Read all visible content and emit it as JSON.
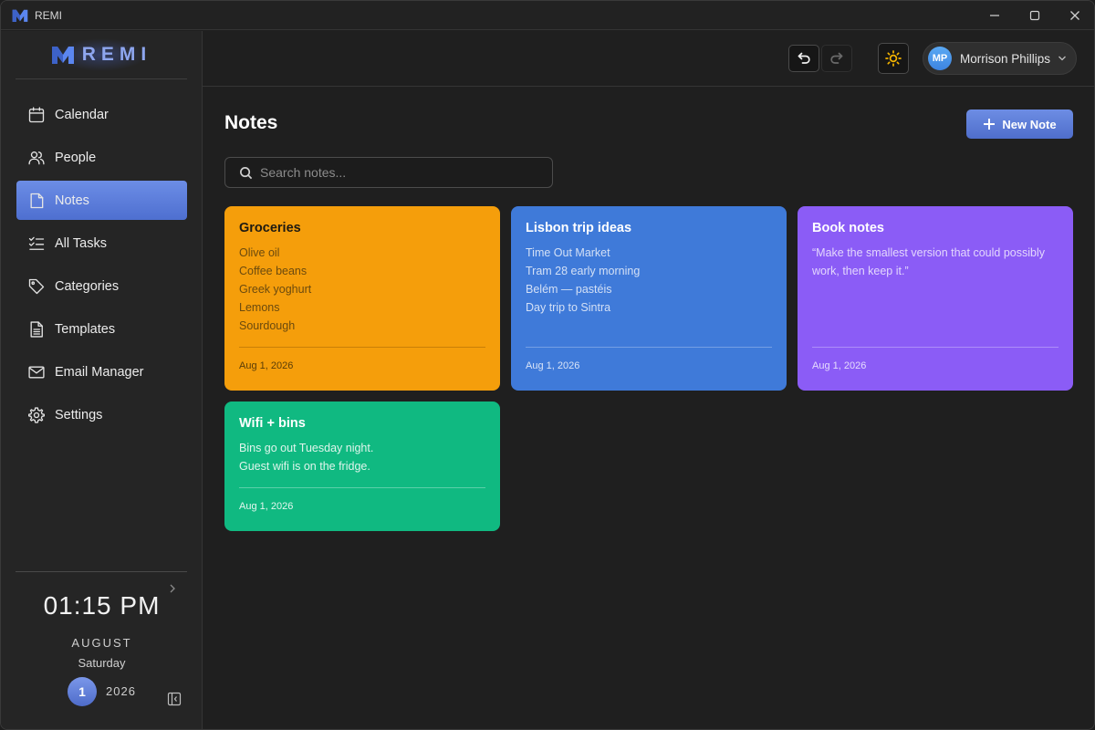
{
  "window": {
    "title": "REMI"
  },
  "brand": {
    "name": "REMI"
  },
  "sidebar": {
    "items": [
      {
        "label": "Calendar",
        "icon": "calendar-icon",
        "active": false
      },
      {
        "label": "People",
        "icon": "people-icon",
        "active": false
      },
      {
        "label": "Notes",
        "icon": "note-icon",
        "active": true
      },
      {
        "label": "All Tasks",
        "icon": "checklist-icon",
        "active": false
      },
      {
        "label": "Categories",
        "icon": "tag-icon",
        "active": false
      },
      {
        "label": "Templates",
        "icon": "document-icon",
        "active": false
      },
      {
        "label": "Email Manager",
        "icon": "mail-icon",
        "active": false
      },
      {
        "label": "Settings",
        "icon": "gear-icon",
        "active": false
      }
    ]
  },
  "clock": {
    "time": "01:15 PM",
    "month": "AUGUST",
    "weekday": "Saturday",
    "day": "1",
    "year": "2026"
  },
  "header": {
    "user_initials": "MP",
    "user_name": "Morrison Phillips"
  },
  "main": {
    "title": "Notes",
    "new_note_label": "New Note",
    "search_placeholder": "Search notes...",
    "notes": [
      {
        "title": "Groceries",
        "lines": [
          "Olive oil",
          "Coffee beans",
          "Greek yoghurt",
          "Lemons",
          "Sourdough"
        ],
        "date": "Aug 1, 2026",
        "color": "#f59e0b"
      },
      {
        "title": "Lisbon trip ideas",
        "lines": [
          "Time Out Market",
          "Tram 28 early morning",
          "Belém — pastéis",
          "Day trip to Sintra"
        ],
        "date": "Aug 1, 2026",
        "color": "#3f7ad9"
      },
      {
        "title": "Book notes",
        "lines": [
          "“Make the smallest version that could possibly",
          "work, then keep it.”"
        ],
        "date": "Aug 1, 2026",
        "color": "#8b5cf6"
      },
      {
        "title": "Wifi + bins",
        "lines": [
          "Bins go out Tuesday night.",
          "Guest wifi is on the fridge."
        ],
        "date": "Aug 1, 2026",
        "color": "#10b981"
      }
    ]
  },
  "colors": {
    "accent": "#5a7bd8",
    "background": "#1f1f1f",
    "sidebar": "#252525"
  }
}
